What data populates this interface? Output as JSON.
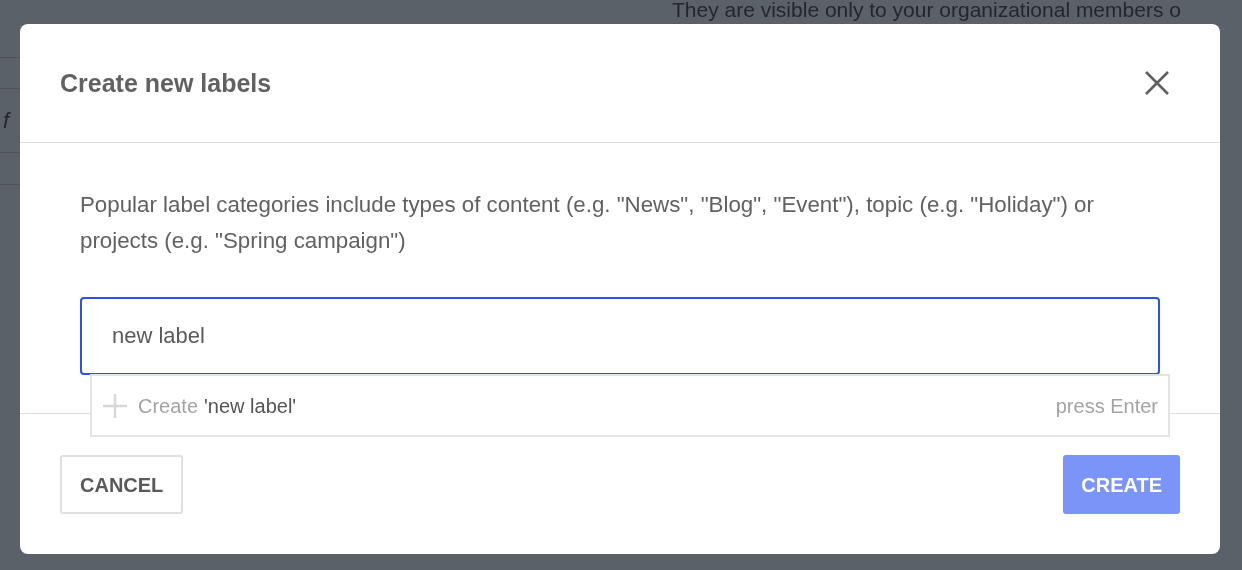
{
  "background": {
    "notice": "They are visible only to your organizational members o",
    "field_fragment": "f"
  },
  "dialog": {
    "title": "Create new labels",
    "description": "Popular label categories include types of content (e.g. \"News\", \"Blog\", \"Event\"), topic (e.g. \"Holiday\") or projects (e.g. \"Spring campaign\")",
    "input": {
      "value": "new label",
      "focused": true
    },
    "suggestion": {
      "action": "Create",
      "value": "'new label'",
      "hint": "press Enter"
    },
    "buttons": [
      {
        "label": "CANCEL",
        "kind": "secondary"
      },
      {
        "label": "CREATE",
        "kind": "primary"
      }
    ]
  }
}
